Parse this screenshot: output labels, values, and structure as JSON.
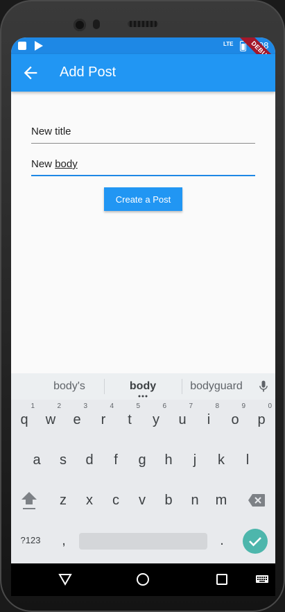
{
  "status_bar": {
    "network": "LTE",
    "time": "1:08",
    "debug_banner": "DEBUG"
  },
  "app_bar": {
    "title": "Add Post"
  },
  "form": {
    "title_field": {
      "value": "New title"
    },
    "body_field": {
      "value_prefix": "New ",
      "value_underlined": "body"
    },
    "create_button": "Create a Post"
  },
  "keyboard": {
    "suggestions": [
      "body's",
      "body",
      "bodyguard"
    ],
    "row1": [
      {
        "key": "q",
        "hint": "1"
      },
      {
        "key": "w",
        "hint": "2"
      },
      {
        "key": "e",
        "hint": "3"
      },
      {
        "key": "r",
        "hint": "4"
      },
      {
        "key": "t",
        "hint": "5"
      },
      {
        "key": "y",
        "hint": "6"
      },
      {
        "key": "u",
        "hint": "7"
      },
      {
        "key": "i",
        "hint": "8"
      },
      {
        "key": "o",
        "hint": "9"
      },
      {
        "key": "p",
        "hint": "0"
      }
    ],
    "row2": [
      "a",
      "s",
      "d",
      "f",
      "g",
      "h",
      "j",
      "k",
      "l"
    ],
    "row3": [
      "z",
      "x",
      "c",
      "v",
      "b",
      "n",
      "m"
    ],
    "symbols_key": "?123",
    "comma_key": ",",
    "period_key": "."
  },
  "colors": {
    "app_bar": "#2196f3",
    "status_bar": "#1e88e5",
    "focus_line": "#1e88e5",
    "enter_key": "#4db6ac"
  },
  "icons": {
    "back": "arrow-left-icon",
    "mic": "microphone-icon",
    "shift": "shift-icon",
    "backspace": "backspace-icon",
    "enter": "checkmark-icon",
    "nav_back": "triangle-back-icon",
    "nav_home": "circle-home-icon",
    "nav_recents": "square-recents-icon",
    "nav_keyboard": "keyboard-icon"
  }
}
